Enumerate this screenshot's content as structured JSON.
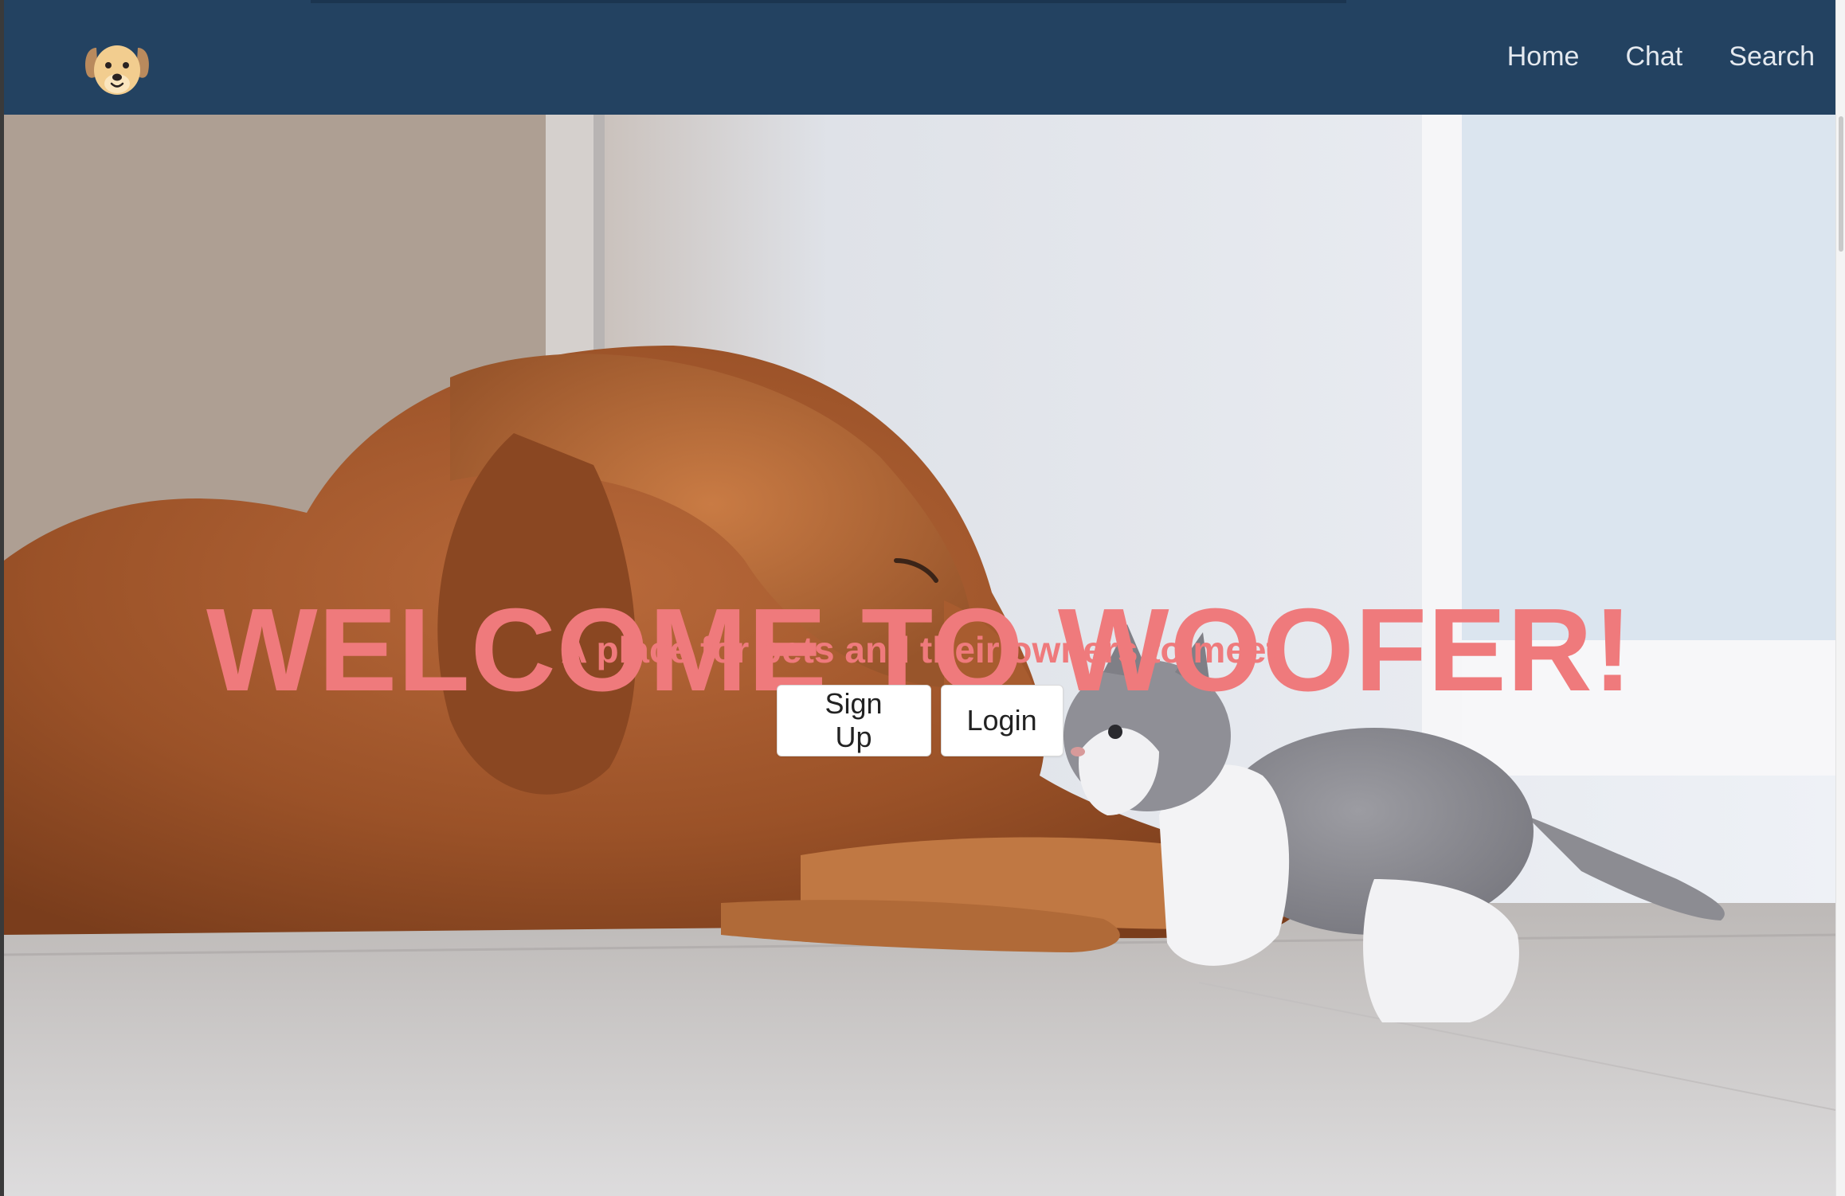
{
  "brand": {
    "logo": "dog-face-logo-icon"
  },
  "nav": {
    "links": [
      {
        "label": "Home"
      },
      {
        "label": "Chat"
      },
      {
        "label": "Search"
      }
    ]
  },
  "hero": {
    "image": "golden-retriever-and-kitten-photo",
    "title": "WELCOME TO WOOFER!",
    "subtitle": "A place for pets and their owners to meet",
    "buttons": {
      "signup": "Sign Up",
      "login": "Login"
    }
  },
  "colors": {
    "navbar": "#234261",
    "nav_text": "#e4e9ef",
    "accent_text": "#ef7a7c",
    "button_bg": "#ffffff",
    "button_text": "#222222"
  }
}
